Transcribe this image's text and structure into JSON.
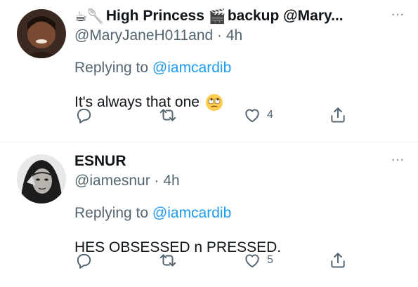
{
  "tweets": [
    {
      "emojis": "☕🥄",
      "display_name": "High Princess",
      "clapper_emoji": "🎬",
      "name_suffix": "backup @Mary...",
      "handle": "@MaryJaneH011and",
      "time": "· 4h",
      "replying_prefix": "Replying to",
      "replying_to": "@iamcardib",
      "text": "It's always that one",
      "likes": "4",
      "more": "···"
    },
    {
      "display_name": "ESNUR",
      "handle": "@iamesnur",
      "time": "· 4h",
      "replying_prefix": "Replying to",
      "replying_to": "@iamcardib",
      "text": "HES OBSESSED n PRESSED.",
      "likes": "5",
      "more": "···"
    }
  ],
  "colors": {
    "text": "#0f1419",
    "secondary": "#536471",
    "link": "#1d9bf0",
    "divider": "#eff3f4"
  },
  "icons": [
    "reply-icon",
    "retweet-icon",
    "like-icon",
    "share-icon",
    "more-icon",
    "face-with-rolling-eyes-emoji"
  ]
}
